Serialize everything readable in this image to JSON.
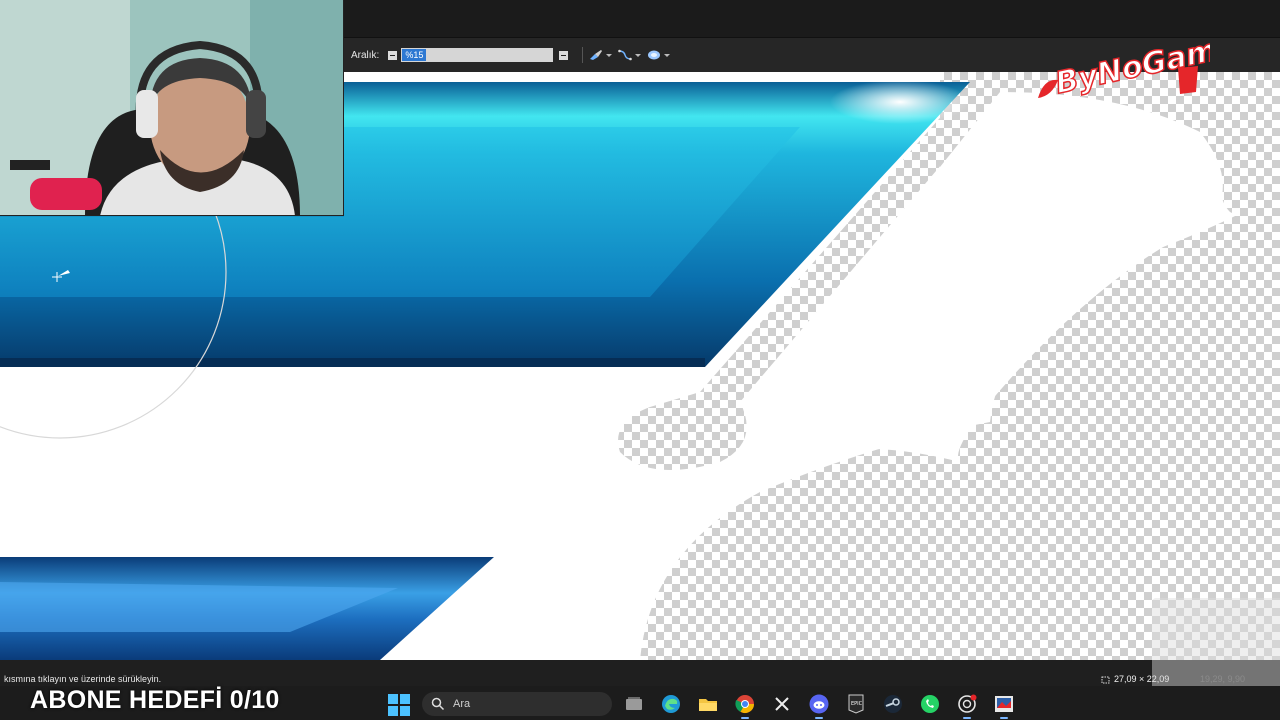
{
  "options_bar": {
    "range_label": "Aralık:",
    "range_value": "%15"
  },
  "status_bar": {
    "hint": "kısmına tıklayın ve üzerinde sürükleyin.",
    "dimensions": "27,09 × 22,09",
    "position": "19,29, 9,90"
  },
  "overlay": {
    "goal_text": "ABONE HEDEFİ 0/10",
    "logo_text": "ByNoGam"
  },
  "taskbar": {
    "search_placeholder": "Ara",
    "pinned": [
      "task-view-icon",
      "edge-icon",
      "explorer-icon",
      "chrome-icon",
      "x-icon",
      "discord-icon",
      "epic-games-icon",
      "steam-icon",
      "whatsapp-icon",
      "chatgpt-icon",
      "image-editor-icon"
    ]
  },
  "colors": {
    "accent_blue": "#2d78d2",
    "logo_red": "#e5262a",
    "canvas_cyan": "#25c6e6",
    "canvas_dark_blue": "#0b4f86"
  }
}
